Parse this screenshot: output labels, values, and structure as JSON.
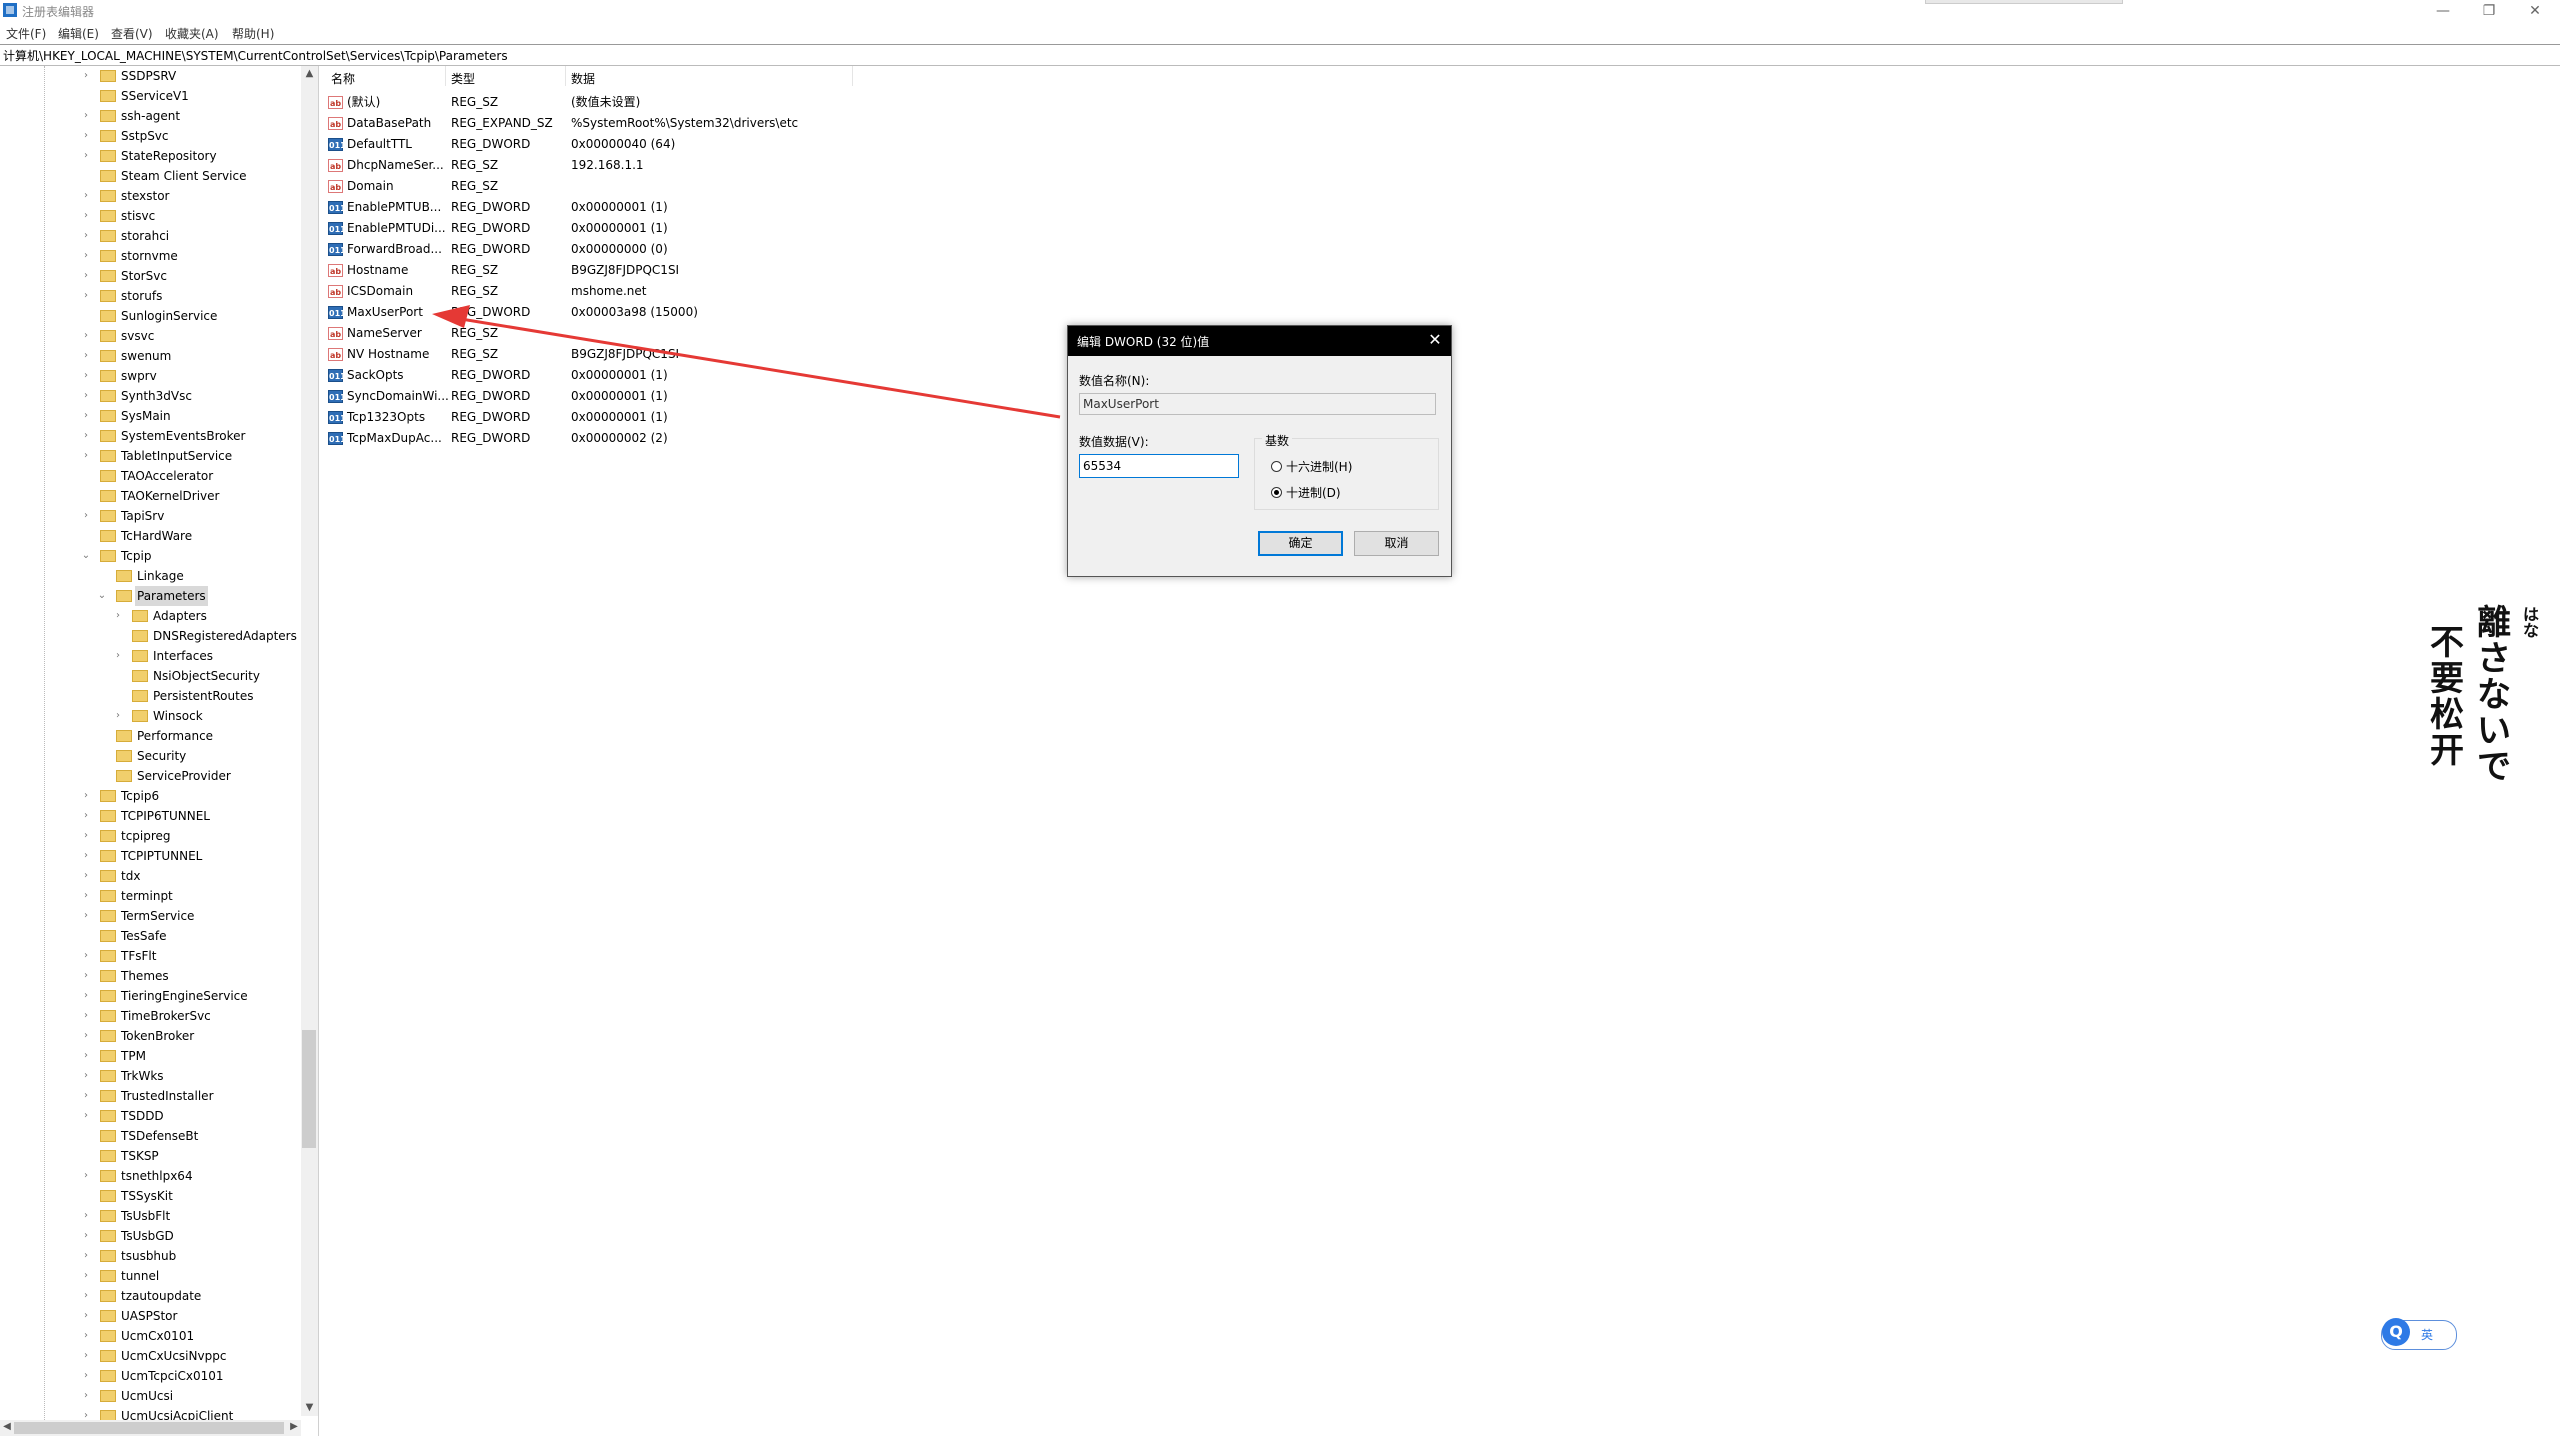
{
  "window": {
    "title": "注册表编辑器",
    "minimize_glyph": "—",
    "restore_glyph": "❐",
    "close_glyph": "✕"
  },
  "menu": [
    "文件(F)",
    "编辑(E)",
    "查看(V)",
    "收藏夹(A)",
    "帮助(H)"
  ],
  "address": "计算机\\HKEY_LOCAL_MACHINE\\SYSTEM\\CurrentControlSet\\Services\\Tcpip\\Parameters",
  "tree": [
    {
      "label": "SSDPSRV",
      "level": 0,
      "expander": "›"
    },
    {
      "label": "SServiceV1",
      "level": 0,
      "expander": ""
    },
    {
      "label": "ssh-agent",
      "level": 0,
      "expander": "›"
    },
    {
      "label": "SstpSvc",
      "level": 0,
      "expander": "›"
    },
    {
      "label": "StateRepository",
      "level": 0,
      "expander": "›"
    },
    {
      "label": "Steam Client Service",
      "level": 0,
      "expander": ""
    },
    {
      "label": "stexstor",
      "level": 0,
      "expander": "›"
    },
    {
      "label": "stisvc",
      "level": 0,
      "expander": "›"
    },
    {
      "label": "storahci",
      "level": 0,
      "expander": "›"
    },
    {
      "label": "stornvme",
      "level": 0,
      "expander": "›"
    },
    {
      "label": "StorSvc",
      "level": 0,
      "expander": "›"
    },
    {
      "label": "storufs",
      "level": 0,
      "expander": "›"
    },
    {
      "label": "SunloginService",
      "level": 0,
      "expander": ""
    },
    {
      "label": "svsvc",
      "level": 0,
      "expander": "›"
    },
    {
      "label": "swenum",
      "level": 0,
      "expander": "›"
    },
    {
      "label": "swprv",
      "level": 0,
      "expander": "›"
    },
    {
      "label": "Synth3dVsc",
      "level": 0,
      "expander": "›"
    },
    {
      "label": "SysMain",
      "level": 0,
      "expander": "›"
    },
    {
      "label": "SystemEventsBroker",
      "level": 0,
      "expander": "›"
    },
    {
      "label": "TabletInputService",
      "level": 0,
      "expander": "›"
    },
    {
      "label": "TAOAccelerator",
      "level": 0,
      "expander": ""
    },
    {
      "label": "TAOKernelDriver",
      "level": 0,
      "expander": ""
    },
    {
      "label": "TapiSrv",
      "level": 0,
      "expander": "›"
    },
    {
      "label": "TcHardWare",
      "level": 0,
      "expander": ""
    },
    {
      "label": "Tcpip",
      "level": 0,
      "expander": "⌄"
    },
    {
      "label": "Linkage",
      "level": 1,
      "expander": ""
    },
    {
      "label": "Parameters",
      "level": 1,
      "expander": "⌄",
      "selected": true
    },
    {
      "label": "Adapters",
      "level": 2,
      "expander": "›"
    },
    {
      "label": "DNSRegisteredAdapters",
      "level": 2,
      "expander": ""
    },
    {
      "label": "Interfaces",
      "level": 2,
      "expander": "›"
    },
    {
      "label": "NsiObjectSecurity",
      "level": 2,
      "expander": ""
    },
    {
      "label": "PersistentRoutes",
      "level": 2,
      "expander": ""
    },
    {
      "label": "Winsock",
      "level": 2,
      "expander": "›"
    },
    {
      "label": "Performance",
      "level": 1,
      "expander": ""
    },
    {
      "label": "Security",
      "level": 1,
      "expander": ""
    },
    {
      "label": "ServiceProvider",
      "level": 1,
      "expander": ""
    },
    {
      "label": "Tcpip6",
      "level": 0,
      "expander": "›"
    },
    {
      "label": "TCPIP6TUNNEL",
      "level": 0,
      "expander": "›"
    },
    {
      "label": "tcpipreg",
      "level": 0,
      "expander": "›"
    },
    {
      "label": "TCPIPTUNNEL",
      "level": 0,
      "expander": "›"
    },
    {
      "label": "tdx",
      "level": 0,
      "expander": "›"
    },
    {
      "label": "terminpt",
      "level": 0,
      "expander": "›"
    },
    {
      "label": "TermService",
      "level": 0,
      "expander": "›"
    },
    {
      "label": "TesSafe",
      "level": 0,
      "expander": ""
    },
    {
      "label": "TFsFlt",
      "level": 0,
      "expander": "›"
    },
    {
      "label": "Themes",
      "level": 0,
      "expander": "›"
    },
    {
      "label": "TieringEngineService",
      "level": 0,
      "expander": "›"
    },
    {
      "label": "TimeBrokerSvc",
      "level": 0,
      "expander": "›"
    },
    {
      "label": "TokenBroker",
      "level": 0,
      "expander": "›"
    },
    {
      "label": "TPM",
      "level": 0,
      "expander": "›"
    },
    {
      "label": "TrkWks",
      "level": 0,
      "expander": "›"
    },
    {
      "label": "TrustedInstaller",
      "level": 0,
      "expander": "›"
    },
    {
      "label": "TSDDD",
      "level": 0,
      "expander": "›"
    },
    {
      "label": "TSDefenseBt",
      "level": 0,
      "expander": ""
    },
    {
      "label": "TSKSP",
      "level": 0,
      "expander": ""
    },
    {
      "label": "tsnethlpx64",
      "level": 0,
      "expander": "›"
    },
    {
      "label": "TSSysKit",
      "level": 0,
      "expander": ""
    },
    {
      "label": "TsUsbFlt",
      "level": 0,
      "expander": "›"
    },
    {
      "label": "TsUsbGD",
      "level": 0,
      "expander": "›"
    },
    {
      "label": "tsusbhub",
      "level": 0,
      "expander": "›"
    },
    {
      "label": "tunnel",
      "level": 0,
      "expander": "›"
    },
    {
      "label": "tzautoupdate",
      "level": 0,
      "expander": "›"
    },
    {
      "label": "UASPStor",
      "level": 0,
      "expander": "›"
    },
    {
      "label": "UcmCx0101",
      "level": 0,
      "expander": "›"
    },
    {
      "label": "UcmCxUcsiNvppc",
      "level": 0,
      "expander": "›"
    },
    {
      "label": "UcmTcpciCx0101",
      "level": 0,
      "expander": "›"
    },
    {
      "label": "UcmUcsi",
      "level": 0,
      "expander": "›"
    },
    {
      "label": "UcmUcsiAcpiClient",
      "level": 0,
      "expander": "›"
    }
  ],
  "columns": {
    "name": "名称",
    "type": "类型",
    "data": "数据"
  },
  "values": [
    {
      "name": "(默认)",
      "type": "REG_SZ",
      "data": "(数值未设置)",
      "icon": "sz"
    },
    {
      "name": "DataBasePath",
      "type": "REG_EXPAND_SZ",
      "data": "%SystemRoot%\\System32\\drivers\\etc",
      "icon": "sz"
    },
    {
      "name": "DefaultTTL",
      "type": "REG_DWORD",
      "data": "0x00000040 (64)",
      "icon": "dw"
    },
    {
      "name": "DhcpNameSer...",
      "type": "REG_SZ",
      "data": "192.168.1.1",
      "icon": "sz"
    },
    {
      "name": "Domain",
      "type": "REG_SZ",
      "data": "",
      "icon": "sz"
    },
    {
      "name": "EnablePMTUB...",
      "type": "REG_DWORD",
      "data": "0x00000001 (1)",
      "icon": "dw"
    },
    {
      "name": "EnablePMTUDi...",
      "type": "REG_DWORD",
      "data": "0x00000001 (1)",
      "icon": "dw"
    },
    {
      "name": "ForwardBroad...",
      "type": "REG_DWORD",
      "data": "0x00000000 (0)",
      "icon": "dw"
    },
    {
      "name": "Hostname",
      "type": "REG_SZ",
      "data": "B9GZJ8FJDPQC1SI",
      "icon": "sz"
    },
    {
      "name": "ICSDomain",
      "type": "REG_SZ",
      "data": "mshome.net",
      "icon": "sz"
    },
    {
      "name": "MaxUserPort",
      "type": "REG_DWORD",
      "data": "0x00003a98 (15000)",
      "icon": "dw"
    },
    {
      "name": "NameServer",
      "type": "REG_SZ",
      "data": "",
      "icon": "sz"
    },
    {
      "name": "NV Hostname",
      "type": "REG_SZ",
      "data": "B9GZJ8FJDPQC1SI",
      "icon": "sz"
    },
    {
      "name": "SackOpts",
      "type": "REG_DWORD",
      "data": "0x00000001 (1)",
      "icon": "dw"
    },
    {
      "name": "SyncDomainWi...",
      "type": "REG_DWORD",
      "data": "0x00000001 (1)",
      "icon": "dw"
    },
    {
      "name": "Tcp1323Opts",
      "type": "REG_DWORD",
      "data": "0x00000001 (1)",
      "icon": "dw"
    },
    {
      "name": "TcpMaxDupAc...",
      "type": "REG_DWORD",
      "data": "0x00000002 (2)",
      "icon": "dw"
    }
  ],
  "icon_text": {
    "sz": "ab",
    "dw": "011"
  },
  "dialog": {
    "title": "编辑 DWORD (32 位)值",
    "close_glyph": "✕",
    "name_label": "数值名称(N):",
    "name_value": "MaxUserPort",
    "data_label": "数值数据(V):",
    "data_value": "65534",
    "base_label": "基数",
    "hex_label": "十六进制(H)",
    "dec_label": "十进制(D)",
    "ok_label": "确定",
    "cancel_label": "取消"
  },
  "decoration": {
    "col1": "離さないで",
    "col2": "不要松开",
    "ruby": "はな"
  },
  "ime": {
    "q": "Q",
    "lang": "英"
  },
  "colors": {
    "arrow": "#e53935",
    "selection": "#d9d9d9",
    "accent": "#0078d7"
  }
}
